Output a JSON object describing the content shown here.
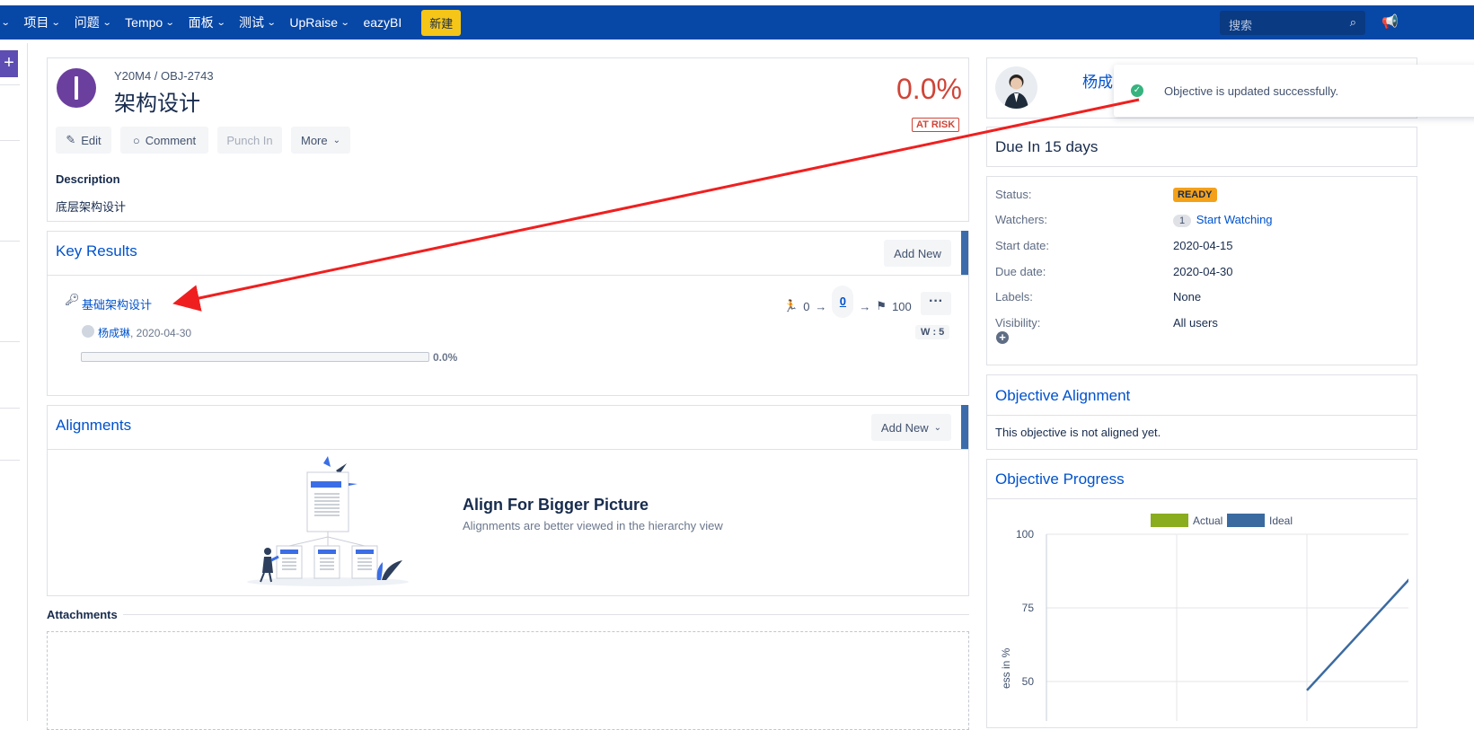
{
  "nav": {
    "items": [
      "项目",
      "问题",
      "Tempo",
      "面板",
      "测试",
      "UpRaise",
      "eazyBI"
    ],
    "create_label": "新建",
    "search_placeholder": "搜索"
  },
  "objective": {
    "breadcrumb": "Y20M4 / OBJ-2743",
    "title": "架构设计",
    "progress_text": "0.0%",
    "progress": 0.0,
    "risk_label": "AT RISK",
    "buttons": {
      "edit": "Edit",
      "comment": "Comment",
      "punch_in": "Punch In",
      "more": "More"
    },
    "description_label": "Description",
    "description": "底层架构设计"
  },
  "key_results": {
    "title": "Key Results",
    "add_new": "Add New",
    "item": {
      "title": "基础架构设计",
      "start": "0",
      "current": "0",
      "target": "100",
      "owner": "杨成琳",
      "date": ", 2020-04-30",
      "weight": "W : 5",
      "progress_text": "0.0%",
      "progress": 0.0
    }
  },
  "alignments": {
    "title": "Alignments",
    "add_new": "Add New",
    "heading": "Align For Bigger Picture",
    "subtext": "Alignments are better viewed in the hierarchy view"
  },
  "attachments": {
    "label": "Attachments"
  },
  "right_panel": {
    "owner_name": "杨成",
    "toast": "Objective is updated successfully.",
    "due": "Due In 15 days",
    "fields": {
      "status_label": "Status:",
      "status": "READY",
      "watchers_label": "Watchers:",
      "watchers_count": "1",
      "watchers_action": "Start Watching",
      "start_label": "Start date:",
      "start": "2020-04-15",
      "due_label": "Due date:",
      "due": "2020-04-30",
      "labels_label": "Labels:",
      "labels": "None",
      "visibility_label": "Visibility:",
      "visibility": "All users"
    },
    "alignment_title": "Objective Alignment",
    "alignment_text": "This objective is not aligned yet.",
    "progress_title": "Objective Progress"
  },
  "colors": {
    "nav": "#0747a6",
    "accent": "#0052cc",
    "risk": "#d04437",
    "actual": "#8aac1f",
    "ideal": "#3b6aa0"
  },
  "chart_data": {
    "type": "line",
    "legend": [
      "Actual",
      "Ideal"
    ],
    "ylabel": "ess in %",
    "y_ticks": [
      "100",
      "75",
      "50"
    ],
    "ylim": [
      0,
      100
    ],
    "series": [
      {
        "name": "Actual",
        "values": []
      },
      {
        "name": "Ideal",
        "x": [
          2,
          3
        ],
        "values": [
          47,
          95
        ]
      }
    ],
    "xlim": [
      0,
      3
    ]
  }
}
